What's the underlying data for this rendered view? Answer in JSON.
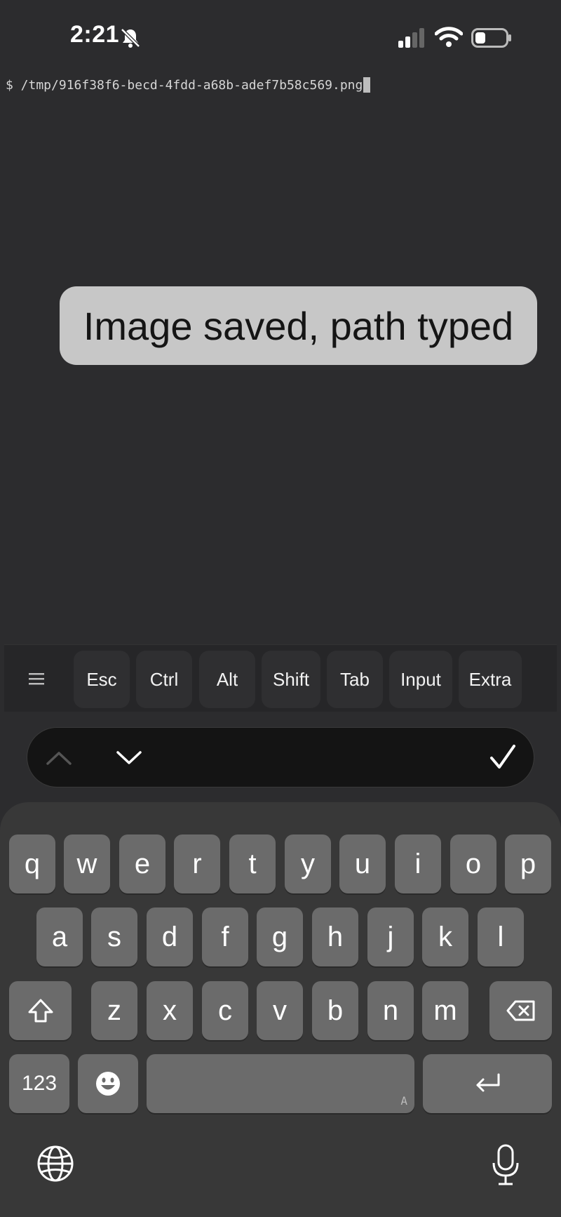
{
  "status_bar": {
    "time": "2:21",
    "icons": [
      "bell-slash-icon",
      "cellular-signal-icon",
      "wifi-icon",
      "battery-icon"
    ]
  },
  "terminal": {
    "prompt_line": "$ /tmp/916f38f6-becd-4fdd-a68b-adef7b58c569.png"
  },
  "toast": {
    "message": "Image saved, path typed"
  },
  "toolbar": {
    "menu_icon": "hamburger-menu-icon",
    "keys": [
      "Esc",
      "Ctrl",
      "Alt",
      "Shift",
      "Tab",
      "Input",
      "Extra"
    ]
  },
  "accessory_bar": {
    "icons": [
      "chevron-up-icon",
      "chevron-down-icon",
      "checkmark-icon"
    ]
  },
  "keyboard": {
    "row1": [
      "q",
      "w",
      "e",
      "r",
      "t",
      "y",
      "u",
      "i",
      "o",
      "p"
    ],
    "row2": [
      "a",
      "s",
      "d",
      "f",
      "g",
      "h",
      "j",
      "k",
      "l"
    ],
    "row3": [
      "z",
      "x",
      "c",
      "v",
      "b",
      "n",
      "m"
    ],
    "numbers_key": "123",
    "space_hint": "A",
    "icons": [
      "shift-icon",
      "delete-icon",
      "emoji-icon",
      "return-icon",
      "globe-icon",
      "microphone-icon"
    ]
  },
  "colors": {
    "background": "#2c2c2e",
    "toast_bg": "#c7c7c7",
    "key_bg": "#6b6b6b",
    "keyboard_bg": "#383838"
  }
}
